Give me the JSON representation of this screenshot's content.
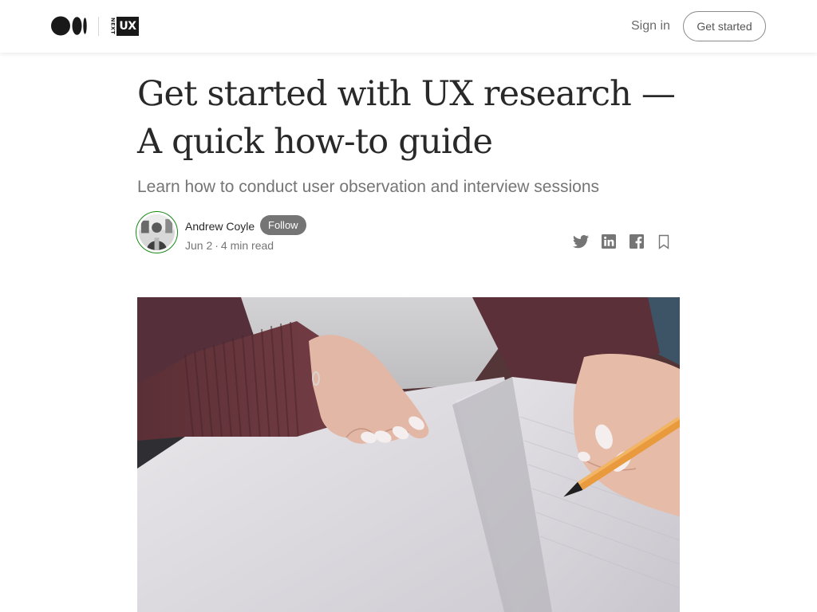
{
  "header": {
    "medium_logo_icon": "medium-logo-icon",
    "publication": {
      "logo_icon": "next-ux-logo",
      "logo_side_text": "NEXT",
      "logo_box_text": "UX"
    },
    "sign_in_label": "Sign in",
    "get_started_label": "Get started"
  },
  "article": {
    "title": "Get started with UX research — A quick how-to guide",
    "subtitle": "Learn how to conduct user observation and interview sessions",
    "author": {
      "name": "Andrew Coyle",
      "follow_label": "Follow",
      "date": "Jun 2",
      "read_time": "4 min read",
      "separator": "·"
    },
    "share_icons": [
      "twitter-icon",
      "linkedin-icon",
      "facebook-icon",
      "bookmark-icon"
    ],
    "hero_image": "photo-hands-writing-in-notebook"
  },
  "colors": {
    "text_primary": "#292929",
    "text_secondary": "#757575",
    "follow_bg": "#757575",
    "avatar_ring": "#1a8917",
    "button_border": "#8a8a8a"
  }
}
